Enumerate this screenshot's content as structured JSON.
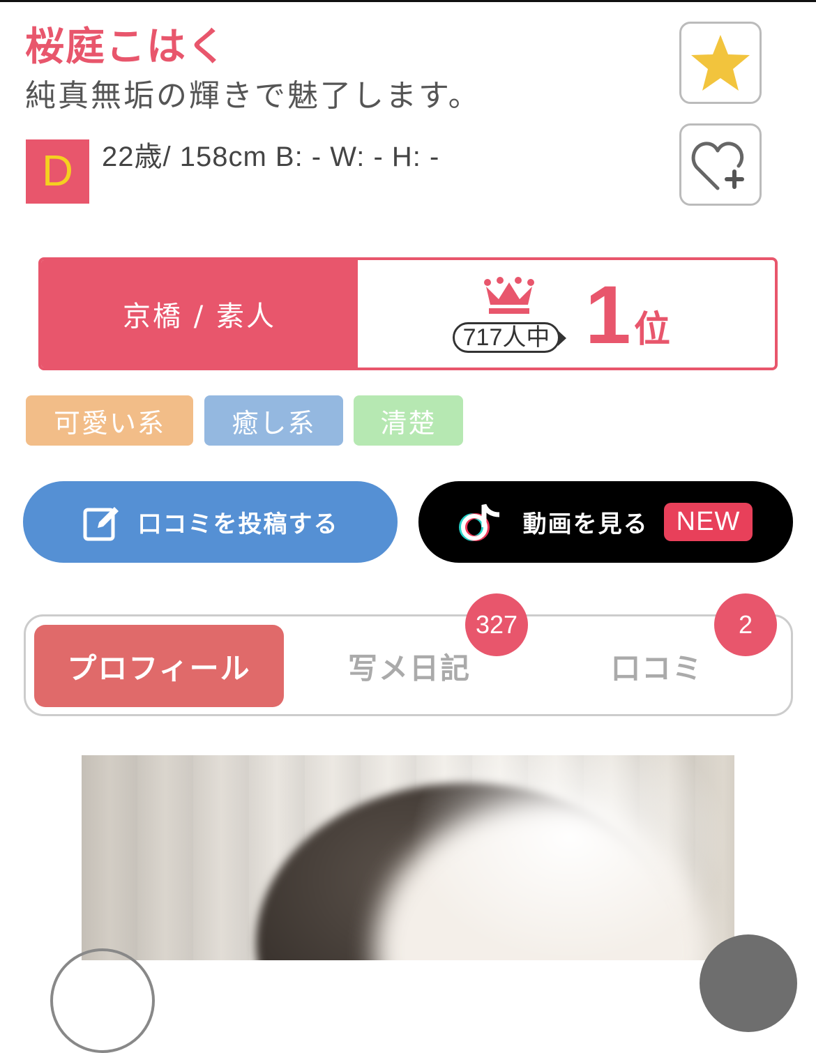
{
  "profile": {
    "name": "桜庭こはく",
    "catchphrase": "純真無垢の輝きで魅了します。",
    "cup": "D",
    "stats": "22歳/ 158cm B: - W: - H: -"
  },
  "actions": {
    "favorite_icon": "star-icon",
    "follow_icon": "heart-plus-icon"
  },
  "ranking": {
    "category": "京橋 / 素人",
    "count": "717人中",
    "rank": "1",
    "unit": "位"
  },
  "tags": [
    {
      "label": "可愛い系",
      "color": "#f2bd88"
    },
    {
      "label": "癒し系",
      "color": "#94b8e0"
    },
    {
      "label": "清楚",
      "color": "#b6e8b2"
    }
  ],
  "buttons": {
    "review": "口コミを投稿する",
    "video": "動画を見る",
    "new_badge": "NEW"
  },
  "tabs": [
    {
      "label": "プロフィール",
      "active": true
    },
    {
      "label": "写メ日記",
      "badge": "327"
    },
    {
      "label": "口コミ",
      "badge": "2"
    }
  ],
  "colors": {
    "accent": "#e8566c",
    "review_button": "#5590d4",
    "video_button": "#000000"
  }
}
